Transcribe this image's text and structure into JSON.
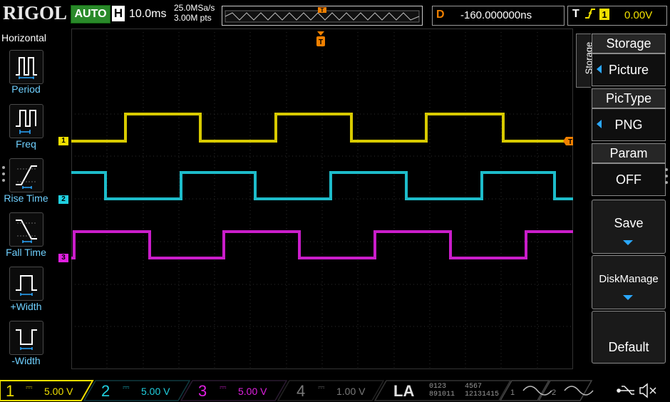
{
  "brand": "RIGOL",
  "run_state": "AUTO",
  "horizontal": {
    "letter": "H",
    "timebase": "10.0ms",
    "sample_rate": "25.0MSa/s",
    "memory_depth": "3.00M pts"
  },
  "delay": {
    "letter": "D",
    "value": "-160.000000ns"
  },
  "trigger": {
    "letter": "T",
    "edge_icon": "rising-edge-icon",
    "source": "1",
    "level": "0.00V"
  },
  "colors": {
    "ch1": "#f0e000",
    "ch2": "#20d0e0",
    "ch3": "#e020e0",
    "ch4": "#7a7a7a",
    "trigger": "#f08000",
    "menu_accent": "#2aa8ff"
  },
  "left_menu": {
    "title": "Horizontal",
    "items": [
      {
        "label": "Period",
        "icon": "period-icon"
      },
      {
        "label": "Freq",
        "icon": "frequency-icon"
      },
      {
        "label": "Rise Time",
        "icon": "rise-time-icon"
      },
      {
        "label": "Fall Time",
        "icon": "fall-time-icon"
      },
      {
        "label": "+Width",
        "icon": "positive-width-icon"
      },
      {
        "label": "-Width",
        "icon": "negative-width-icon"
      }
    ]
  },
  "channel_markers": [
    {
      "label": "1"
    },
    {
      "label": "2"
    },
    {
      "label": "3"
    }
  ],
  "trigger_marker_label": "T",
  "right_menu": {
    "tab": "Storage",
    "sections": [
      {
        "header": "Storage",
        "value": "Picture"
      },
      {
        "header": "PicType",
        "value": "PNG"
      },
      {
        "header": "Param",
        "value": "OFF"
      }
    ],
    "buttons": [
      "Save",
      "DiskManage",
      "Default"
    ]
  },
  "bottom": {
    "channels": [
      {
        "num": "1",
        "coupling": "DC",
        "scale": "5.00 V"
      },
      {
        "num": "2",
        "coupling": "DC",
        "scale": "5.00 V"
      },
      {
        "num": "3",
        "coupling": "DC",
        "scale": "5.00 V"
      },
      {
        "num": "4",
        "coupling": "DC",
        "scale": "1.00 V"
      }
    ],
    "la_label": "LA",
    "la_digits_top_a": "0123",
    "la_digits_bottom_a": "891011",
    "la_digits_top_b": "4567",
    "la_digits_bottom_b": "12131415",
    "generators": [
      {
        "num": "1",
        "icon": "sine-wave-icon"
      },
      {
        "num": "2",
        "icon": "sine-wave-icon"
      }
    ],
    "status_icons": [
      "usb-icon",
      "sound-muted-icon"
    ]
  }
}
